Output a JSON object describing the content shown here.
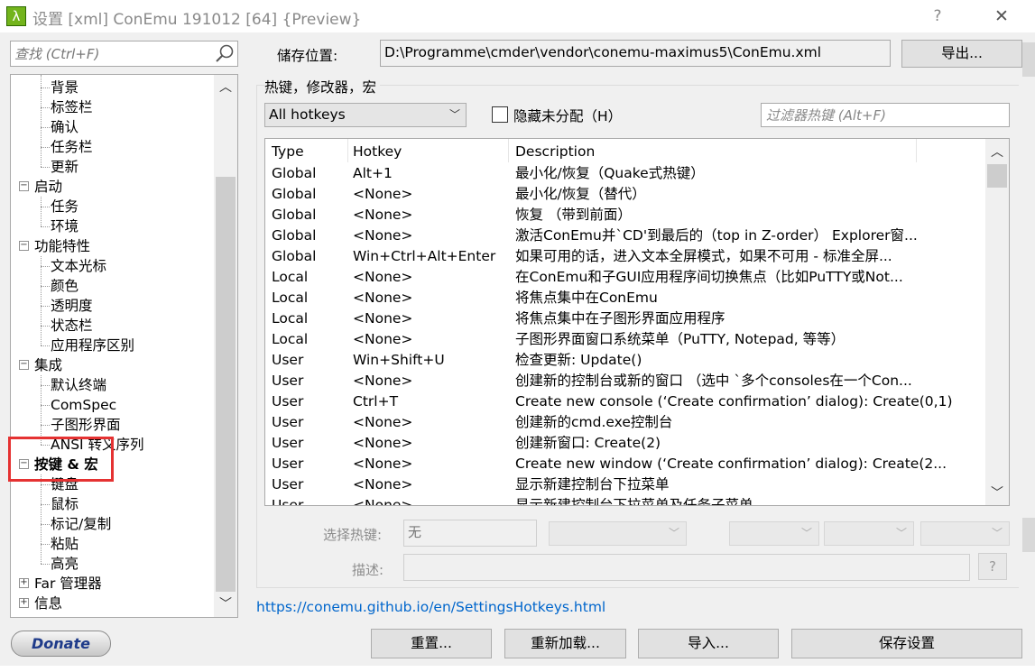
{
  "window": {
    "title": "设置 [xml] ConEmu 191012 [64] {Preview}",
    "app_icon": "λ",
    "help": "?",
    "close": "✕"
  },
  "search": {
    "placeholder": "查找 (Ctrl+F)"
  },
  "tree": {
    "items": [
      {
        "label": "背景",
        "level": 2
      },
      {
        "label": "标签栏",
        "level": 2
      },
      {
        "label": "确认",
        "level": 2
      },
      {
        "label": "任务栏",
        "level": 2
      },
      {
        "label": "更新",
        "level": 2
      },
      {
        "label": "启动",
        "level": 1,
        "expander": "−"
      },
      {
        "label": "任务",
        "level": 2
      },
      {
        "label": "环境",
        "level": 2
      },
      {
        "label": "功能特性",
        "level": 1,
        "expander": "−"
      },
      {
        "label": "文本光标",
        "level": 2
      },
      {
        "label": "颜色",
        "level": 2
      },
      {
        "label": "透明度",
        "level": 2
      },
      {
        "label": "状态栏",
        "level": 2
      },
      {
        "label": "应用程序区别",
        "level": 2
      },
      {
        "label": "集成",
        "level": 1,
        "expander": "−"
      },
      {
        "label": "默认终端",
        "level": 2
      },
      {
        "label": "ComSpec",
        "level": 2
      },
      {
        "label": "子图形界面",
        "level": 2
      },
      {
        "label": "ANSI 转义序列",
        "level": 2
      },
      {
        "label": "按键 & 宏",
        "level": 1,
        "expander": "−",
        "selected": true
      },
      {
        "label": "键盘",
        "level": 2
      },
      {
        "label": "鼠标",
        "level": 2
      },
      {
        "label": "标记/复制",
        "level": 2
      },
      {
        "label": "粘贴",
        "level": 2
      },
      {
        "label": "高亮",
        "level": 2
      },
      {
        "label": "Far 管理器",
        "level": 1,
        "expander": "+"
      },
      {
        "label": "信息",
        "level": 1,
        "expander": "+"
      }
    ],
    "highlight_color": "#e53232"
  },
  "donate_label": "Donate",
  "storage": {
    "label": "储存位置:",
    "path": "D:\\Programme\\cmder\\vendor\\conemu-maximus5\\ConEmu.xml",
    "export_label": "导出..."
  },
  "hotkeys": {
    "group_label": "热键，修改器，宏",
    "filter_select": "All hotkeys",
    "hide_unassigned_label": "隐藏未分配（H）",
    "filter_placeholder": "过滤器热键 (Alt+F)",
    "columns": [
      "Type",
      "Hotkey",
      "Description"
    ],
    "rows": [
      {
        "type": "Global",
        "hotkey": "Alt+1",
        "description": "最小化/恢复（Quake式热键）"
      },
      {
        "type": "Global",
        "hotkey": "<None>",
        "description": "最小化/恢复（替代）"
      },
      {
        "type": "Global",
        "hotkey": "<None>",
        "description": "恢复 （带到前面）"
      },
      {
        "type": "Global",
        "hotkey": "<None>",
        "description": "激活ConEmu并`CD'到最后的（top in Z-order） Explorer窗..."
      },
      {
        "type": "Global",
        "hotkey": "Win+Ctrl+Alt+Enter",
        "description": "如果可用的话，进入文本全屏模式，如果不可用 - 标准全屏..."
      },
      {
        "type": "Local",
        "hotkey": "<None>",
        "description": "在ConEmu和子GUI应用程序间切换焦点（比如PuTTY或Not..."
      },
      {
        "type": "Local",
        "hotkey": "<None>",
        "description": "将焦点集中在ConEmu"
      },
      {
        "type": "Local",
        "hotkey": "<None>",
        "description": "将焦点集中在子图形界面应用程序"
      },
      {
        "type": "Local",
        "hotkey": "<None>",
        "description": "子图形界面窗口系统菜单（PuTTY, Notepad, 等等）"
      },
      {
        "type": "User",
        "hotkey": "Win+Shift+U",
        "description": "检查更新: Update()"
      },
      {
        "type": "User",
        "hotkey": "<None>",
        "description": "创建新的控制台或新的窗口 （选中 `多个consoles在一个Con..."
      },
      {
        "type": "User",
        "hotkey": "Ctrl+T",
        "description": "Create new console (‘Create confirmation’ dialog): Create(0,1)"
      },
      {
        "type": "User",
        "hotkey": "<None>",
        "description": "创建新的cmd.exe控制台"
      },
      {
        "type": "User",
        "hotkey": "<None>",
        "description": "创建新窗口: Create(2)"
      },
      {
        "type": "User",
        "hotkey": "<None>",
        "description": "Create new window (‘Create confirmation’ dialog): Create(2..."
      },
      {
        "type": "User",
        "hotkey": "<None>",
        "description": "显示新建控制台下拉菜单"
      },
      {
        "type": "User",
        "hotkey": "<None>",
        "description": "显示新建控制台下拉菜单及任务子菜单"
      }
    ],
    "choose_hotkey_label": "选择热键:",
    "choose_hotkey_value": "无",
    "description_label": "描述:",
    "help_button": "?"
  },
  "link": "https://conemu.github.io/en/SettingsHotkeys.html",
  "buttons": {
    "reset": "重置...",
    "reload": "重新加载...",
    "import": "导入...",
    "save": "保存设置"
  }
}
